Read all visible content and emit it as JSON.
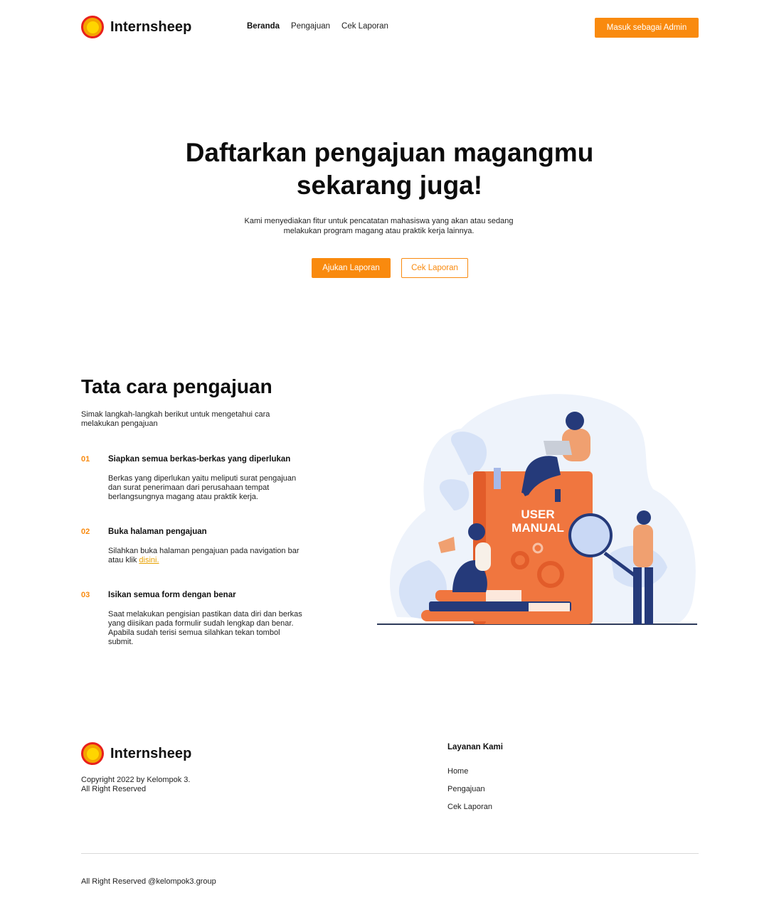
{
  "brand": {
    "name": "Internsheep",
    "accent": "#f98a0e"
  },
  "nav": {
    "links": [
      "Beranda",
      "Pengajuan",
      "Cek Laporan"
    ],
    "active": "Beranda",
    "admin_button": "Masuk sebagai Admin"
  },
  "hero": {
    "title_line1": "Daftarkan pengajuan magangmu",
    "title_line2": "sekarang juga!",
    "desc_line1": "Kami menyediakan fitur untuk pencatatan mahasiswa yang akan atau sedang",
    "desc_line2": "melakukan program magang atau praktik kerja lainnya.",
    "primary_button": "Ajukan Laporan",
    "secondary_button": "Cek Laporan"
  },
  "steps": {
    "title": "Tata cara pengajuan",
    "subtitle_line1": "Simak langkah-langkah berikut untuk mengetahui cara",
    "subtitle_line2": "melakukan pengajuan",
    "items": [
      {
        "num": "01",
        "title": "Siapkan semua berkas-berkas yang diperlukan",
        "lines": [
          "Berkas yang diperlukan yaitu meliputi surat pengajuan",
          "dan surat penerimaan dari perusahaan tempat",
          "berlangsungnya magang atau praktik kerja."
        ]
      },
      {
        "num": "02",
        "title": "Buka halaman pengajuan",
        "lines": [
          "Silahkan buka halaman pengajuan pada navigation bar",
          "atau klik "
        ],
        "link": "disini."
      },
      {
        "num": "03",
        "title": "Isikan semua form dengan benar",
        "lines": [
          "Saat melakukan pengisian pastikan data diri dan berkas",
          "yang diisikan pada formulir sudah lengkap dan benar.",
          "Apabila sudah terisi semua silahkan tekan tombol",
          "submit."
        ]
      }
    ]
  },
  "illustration": {
    "book_line1": "USER",
    "book_line2": "MANUAL",
    "icon": "user-manual-illustration"
  },
  "footer": {
    "brand": "Internsheep",
    "copyright_line1": "Copyright 2022 by Kelompok 3.",
    "copyright_line2": "All Right Reserved",
    "column_title": "Layanan Kami",
    "links": [
      "Home",
      "Pengajuan",
      "Cek Laporan"
    ],
    "bottom": "All Right Reserved @kelompok3.group"
  }
}
